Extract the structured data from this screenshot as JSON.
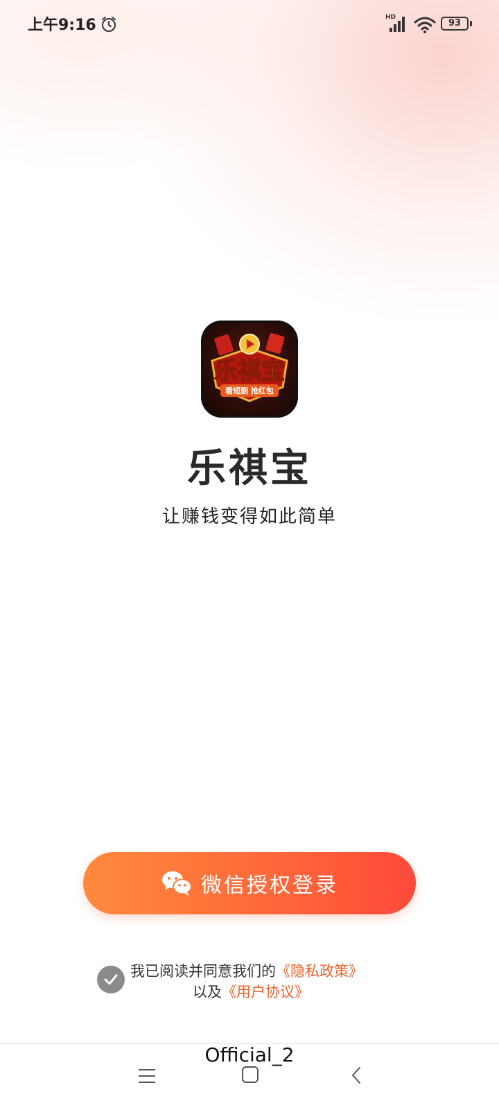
{
  "status_bar": {
    "time": "上午9:16",
    "signal_badge": "HD",
    "battery": "93",
    "icons": [
      "alarm-icon",
      "signal-icon",
      "wifi-icon",
      "battery-icon"
    ]
  },
  "app": {
    "logo_text": "乐祺宝",
    "logo_subtext": "看短剧 抢红包",
    "name": "乐祺宝",
    "slogan": "让赚钱变得如此简单"
  },
  "login": {
    "button_label": "微信授权登录",
    "icon": "wechat-icon"
  },
  "agreement": {
    "prefix": "我已阅读并同意我们的",
    "privacy_link": "《隐私政策》",
    "middle": "以及",
    "terms_link": "《用户协议》"
  },
  "watermark": "Official_2",
  "nav_bar": {
    "icons": [
      "menu-icon",
      "home-icon",
      "back-icon"
    ]
  },
  "colors": {
    "accent_start": "#ff8a3d",
    "accent_end": "#fe4a3b",
    "link": "#e8632e",
    "check_bg": "#8a8a8a"
  }
}
